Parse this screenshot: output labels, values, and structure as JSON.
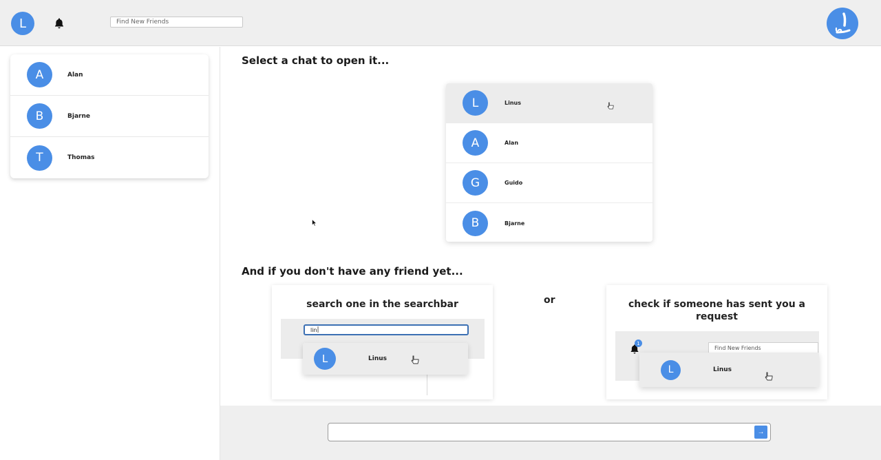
{
  "app": {
    "user_initial": "L",
    "search_placeholder": "Find New Friends",
    "accent": "#4a8ee6"
  },
  "sidebar": {
    "chats": [
      {
        "initial": "A",
        "name": "Alan"
      },
      {
        "initial": "B",
        "name": "Bjarne"
      },
      {
        "initial": "T",
        "name": "Thomas"
      }
    ]
  },
  "main": {
    "select_heading": "Select a chat to open it...",
    "demo_list": [
      {
        "initial": "L",
        "name": "Linus"
      },
      {
        "initial": "A",
        "name": "Alan"
      },
      {
        "initial": "G",
        "name": "Guido"
      },
      {
        "initial": "B",
        "name": "Bjarne"
      }
    ],
    "no_friend_heading": "And if you don't have any friend yet...",
    "or_text": "or",
    "card_search": {
      "title": "search one in the searchbar",
      "typed_query": "lin",
      "result_initial": "L",
      "result_name": "Linus"
    },
    "card_request": {
      "title": "check if someone has sent you a request",
      "notification_count": "1",
      "search_placeholder": "Find New Friends",
      "result_initial": "L",
      "result_name": "Linus"
    }
  },
  "composer": {
    "message_value": "",
    "send_label": "→"
  }
}
